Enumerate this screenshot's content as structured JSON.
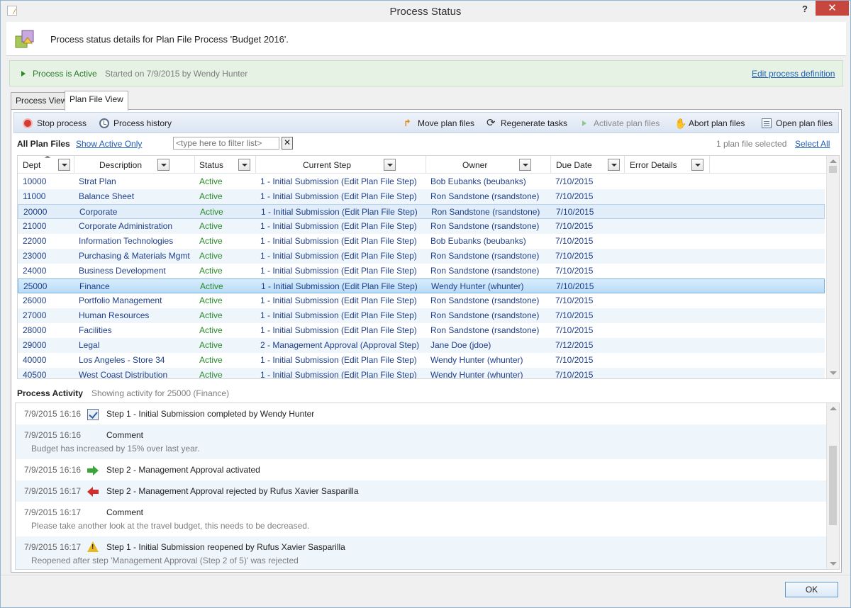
{
  "window": {
    "title": "Process Status",
    "help_label": "?",
    "close_label": "✕"
  },
  "header": {
    "text": "Process status details for Plan File Process 'Budget 2016'."
  },
  "status_bar": {
    "state": "Process is Active",
    "started": "Started on 7/9/2015 by Wendy Hunter",
    "edit_link": "Edit process definition"
  },
  "tabs": [
    {
      "label": "Process View"
    },
    {
      "label": "Plan File View"
    }
  ],
  "toolbar": {
    "stop": "Stop process",
    "history": "Process history",
    "move": "Move plan files",
    "regenerate": "Regenerate tasks",
    "activate": "Activate plan files",
    "abort": "Abort plan files",
    "open": "Open plan files"
  },
  "plan_files": {
    "label": "All Plan Files",
    "show_active": "Show Active Only",
    "filter_placeholder": "<type here to filter list>",
    "clear_label": "✕",
    "selected_count": "1 plan file selected",
    "select_all": "Select All",
    "columns": [
      "Dept",
      "Description",
      "Status",
      "Current Step",
      "Owner",
      "Due Date",
      "Error Details"
    ],
    "rows": [
      {
        "dept": "10000",
        "desc": "Strat Plan",
        "status": "Active",
        "step": "1 - Initial Submission  (Edit Plan File Step)",
        "owner": "Bob Eubanks (beubanks)",
        "due": "7/10/2015"
      },
      {
        "dept": "11000",
        "desc": "Balance Sheet",
        "status": "Active",
        "step": "1 - Initial Submission  (Edit Plan File Step)",
        "owner": "Ron Sandstone (rsandstone)",
        "due": "7/10/2015"
      },
      {
        "dept": "20000",
        "desc": "Corporate",
        "status": "Active",
        "step": "1 - Initial Submission  (Edit Plan File Step)",
        "owner": "Ron Sandstone (rsandstone)",
        "due": "7/10/2015"
      },
      {
        "dept": "21000",
        "desc": "Corporate Administration",
        "status": "Active",
        "step": "1 - Initial Submission  (Edit Plan File Step)",
        "owner": "Ron Sandstone (rsandstone)",
        "due": "7/10/2015"
      },
      {
        "dept": "22000",
        "desc": "Information Technologies",
        "status": "Active",
        "step": "1 - Initial Submission  (Edit Plan File Step)",
        "owner": "Bob Eubanks (beubanks)",
        "due": "7/10/2015"
      },
      {
        "dept": "23000",
        "desc": "Purchasing & Materials Mgmt",
        "status": "Active",
        "step": "1 - Initial Submission  (Edit Plan File Step)",
        "owner": "Ron Sandstone (rsandstone)",
        "due": "7/10/2015"
      },
      {
        "dept": "24000",
        "desc": "Business Development",
        "status": "Active",
        "step": "1 - Initial Submission  (Edit Plan File Step)",
        "owner": "Ron Sandstone (rsandstone)",
        "due": "7/10/2015"
      },
      {
        "dept": "25000",
        "desc": "Finance",
        "status": "Active",
        "step": "1 - Initial Submission  (Edit Plan File Step)",
        "owner": "Wendy Hunter (whunter)",
        "due": "7/10/2015"
      },
      {
        "dept": "26000",
        "desc": "Portfolio Management",
        "status": "Active",
        "step": "1 - Initial Submission  (Edit Plan File Step)",
        "owner": "Ron Sandstone (rsandstone)",
        "due": "7/10/2015"
      },
      {
        "dept": "27000",
        "desc": "Human Resources",
        "status": "Active",
        "step": "1 - Initial Submission  (Edit Plan File Step)",
        "owner": "Ron Sandstone (rsandstone)",
        "due": "7/10/2015"
      },
      {
        "dept": "28000",
        "desc": "Facilities",
        "status": "Active",
        "step": "1 - Initial Submission  (Edit Plan File Step)",
        "owner": "Ron Sandstone (rsandstone)",
        "due": "7/10/2015"
      },
      {
        "dept": "29000",
        "desc": "Legal",
        "status": "Active",
        "step": "2 - Management Approval  (Approval Step)",
        "owner": "Jane Doe (jdoe)",
        "due": "7/12/2015"
      },
      {
        "dept": "40000",
        "desc": "Los Angeles - Store 34",
        "status": "Active",
        "step": "1 - Initial Submission  (Edit Plan File Step)",
        "owner": "Wendy Hunter (whunter)",
        "due": "7/10/2015"
      },
      {
        "dept": "40500",
        "desc": "West Coast Distribution",
        "status": "Active",
        "step": "1 - Initial Submission  (Edit Plan File Step)",
        "owner": "Wendy Hunter (whunter)",
        "due": "7/10/2015"
      }
    ]
  },
  "activity": {
    "label": "Process Activity",
    "showing": "Showing activity for 25000 (Finance)",
    "items": [
      {
        "time": "7/9/2015 16:16",
        "icon": "checkbox-icon",
        "text": "Step  1 - Initial Submission  completed by Wendy Hunter",
        "sub": ""
      },
      {
        "time": "7/9/2015 16:16",
        "icon": "",
        "text": "Comment",
        "sub": "Budget has increased by 15% over last year."
      },
      {
        "time": "7/9/2015 16:16",
        "icon": "green-arrow-right-icon",
        "text": "Step  2 - Management Approval  activated",
        "sub": ""
      },
      {
        "time": "7/9/2015 16:17",
        "icon": "red-arrow-left-icon",
        "text": "Step  2 - Management Approval  rejected by Rufus Xavier Sasparilla",
        "sub": ""
      },
      {
        "time": "7/9/2015 16:17",
        "icon": "",
        "text": "Comment",
        "sub": "Please take another look at the travel budget, this needs to be decreased."
      },
      {
        "time": "7/9/2015 16:17",
        "icon": "warning-icon",
        "text": "Step  1 - Initial Submission  reopened by Rufus Xavier Sasparilla",
        "sub": "Reopened after step 'Management Approval (Step 2 of 5)' was rejected"
      }
    ]
  },
  "footer": {
    "ok": "OK"
  }
}
